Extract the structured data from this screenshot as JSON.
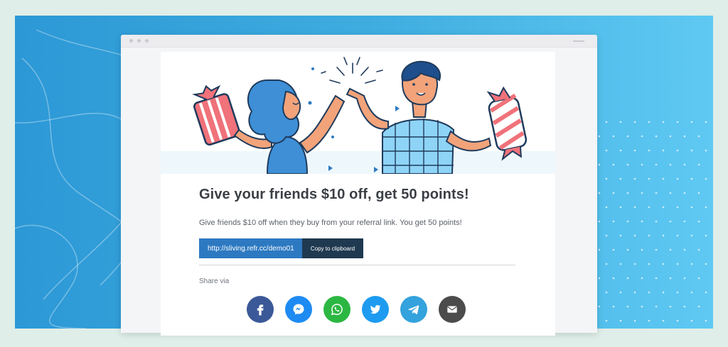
{
  "offer": {
    "headline": "Give your friends $10 off, get 50 points!",
    "description": "Give friends $10 off when they buy from your referral link. You get 50 points!",
    "referral_link": "http://sliving.refr.cc/demo01",
    "copy_button_label": "Copy to clipboard"
  },
  "share": {
    "label": "Share via",
    "buttons": [
      {
        "name": "facebook",
        "icon": "facebook-icon",
        "color": "#3b5998"
      },
      {
        "name": "messenger",
        "icon": "messenger-icon",
        "color": "#1e8bf3"
      },
      {
        "name": "whatsapp",
        "icon": "whatsapp-icon",
        "color": "#2cb742"
      },
      {
        "name": "twitter",
        "icon": "twitter-icon",
        "color": "#1d9bf0"
      },
      {
        "name": "telegram",
        "icon": "telegram-icon",
        "color": "#34a2dc"
      },
      {
        "name": "email",
        "icon": "envelope-icon",
        "color": "#4c4c4c"
      }
    ]
  },
  "colors": {
    "background_gradient_start": "#2c98d6",
    "background_gradient_end": "#5fc9f3",
    "link_field": "#2d79c1",
    "copy_button": "#1f3950",
    "headline": "#3b3f45"
  }
}
